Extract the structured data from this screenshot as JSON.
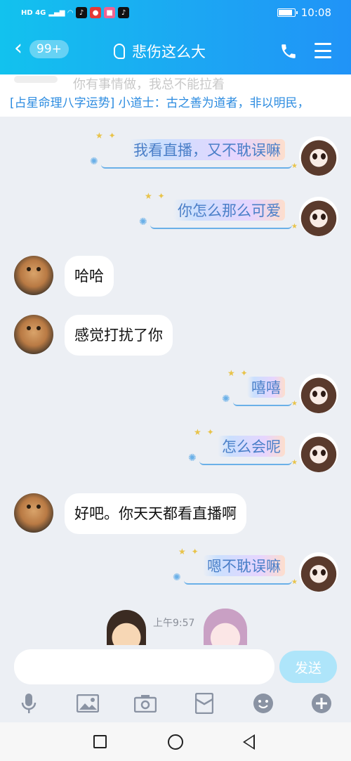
{
  "status_bar": {
    "network": "HD 4G",
    "time": "10:08"
  },
  "header": {
    "back_icon": "chevron-left-icon",
    "unread_badge": "99+",
    "title": "悲伤这么大",
    "title_icon": "ear-icon",
    "call_icon": "phone-icon",
    "menu_icon": "menu-icon"
  },
  "notice": {
    "faded_text": "你有事情做，我总不能拉着",
    "text": "[占星命理八字运势] 小道士：古之善为道者，非以明民，"
  },
  "messages": [
    {
      "side": "right",
      "style": "fancy",
      "text": "我看直播，又不耽误嘛"
    },
    {
      "side": "right",
      "style": "fancy",
      "text": "你怎么那么可爱"
    },
    {
      "side": "left",
      "style": "bubble",
      "text": "哈哈"
    },
    {
      "side": "left",
      "style": "bubble",
      "text": "感觉打扰了你"
    },
    {
      "side": "right",
      "style": "fancy",
      "text": "嘻嘻"
    },
    {
      "side": "right",
      "style": "fancy",
      "text": "怎么会呢"
    },
    {
      "side": "left",
      "style": "bubble",
      "text": "好吧。你天天都看直播啊"
    },
    {
      "side": "right",
      "style": "fancy",
      "text": "嗯不耽误嘛"
    }
  ],
  "timestamp": "上午9:57",
  "input": {
    "value": "",
    "placeholder": "",
    "send_label": "发送"
  },
  "toolbar": {
    "items": [
      "microphone-icon",
      "image-icon",
      "camera-icon",
      "red-packet-icon",
      "emoji-icon",
      "plus-icon"
    ]
  },
  "colors": {
    "header_start": "#12c2ee",
    "header_end": "#2093f7",
    "notice_text": "#2b8be0",
    "send_button": "#aee5fa",
    "fancy_text": "#4a7fc8"
  }
}
